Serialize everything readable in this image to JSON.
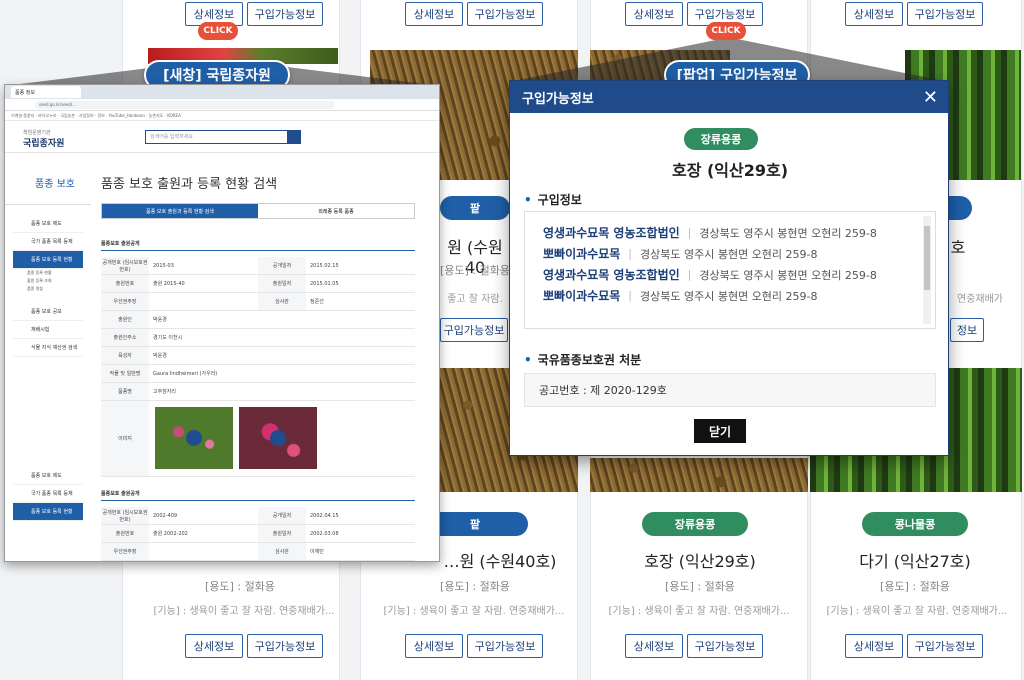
{
  "colors": {
    "navy": "#1f4b8a",
    "blue": "#1f5fa8",
    "green": "#2f8d5f",
    "click_red": "#e8503a"
  },
  "top_buttons": {
    "detail": "상세정보",
    "buy": "구입가능정보"
  },
  "callouts": {
    "click": "CLICK",
    "new_window": "[새창] 국립종자원",
    "popup": "[팝업] 구입가능정보"
  },
  "cards": [
    {
      "badge": "팥",
      "title": "…원 (수원40호)",
      "use": "[용도] : 절화용",
      "func": "[기능] : 생육이 좋고 잘 자람. 연중재배가..."
    },
    {
      "badge": "장류용콩",
      "title": "호장 (익산29호)",
      "use": "[용도] : 절화용",
      "func": "[기능] : 생육이 좋고 잘 자람. 연중재배가..."
    },
    {
      "badge": "콩나물콩",
      "title": "다기 (익산27호)",
      "use": "[용도] : 절화용",
      "func": "[기능] : 생육이 좋고 잘 자람. 연중재배가..."
    }
  ],
  "mid_cards": {
    "badge": "팥",
    "title": "원 (수원40",
    "use": "[용도] : 절화용",
    "func": "좋고 잘 자람."
  },
  "right_mid": {
    "func": "연중재배가"
  },
  "browser": {
    "tab": "품종 정보",
    "url": "seed.go.kr/seed/...",
    "bookmarks": "기계설·품종지 · 바이오누리 · 국립농촌 · 사업정보 · 정보 · YouTube_Hanbeon · 농촌지도 · KOREA",
    "logo_small": "책임운영기관",
    "logo": "국립종자원",
    "search_placeholder": "검색어를 입력하세요",
    "side_title": "품종 보호",
    "side_items": [
      "품종 보호 제도",
      "국가 품종 목록 등재",
      "품종 보호 등록 현황",
      "품종 보호 공보",
      "재배시험",
      "식물 지식 재산권 검색"
    ],
    "side_sub": [
      "품종 등록 현황",
      "출원 등록 조회",
      "품종 명칭"
    ],
    "side_items2": [
      "품종 보호 제도",
      "국가 품종 목록 등재",
      "품종 보호 등록 현황"
    ],
    "page_title": "품종 보호 출원과 등록 현황 검색",
    "tab1": "품종 보호 출원과 등록 현황 검색",
    "tab2": "외래종 등록 품종",
    "sec1": "품종보호 출원공개",
    "rows": [
      {
        "k": "공개번호 (임시보호권번호)",
        "v": "2015-03",
        "k2": "공개일자",
        "v2": "2015.02.15"
      },
      {
        "k": "출원번호",
        "v": "출원 2015-40",
        "k2": "출원일자",
        "v2": "2015.01.05"
      },
      {
        "k": "우선권주장",
        "v": "",
        "k2": "심사관",
        "v2": "정준선"
      },
      {
        "k": "출원인",
        "v": "박윤경",
        "k2": "",
        "v2": ""
      },
      {
        "k": "출원인주소",
        "v": "경기도 이천시",
        "k2": "",
        "v2": ""
      },
      {
        "k": "육성자",
        "v": "박윤경",
        "k2": "",
        "v2": ""
      },
      {
        "k": "작물 및 일반명",
        "v": "Gaura lindheimeri (가우라)",
        "k2": "",
        "v2": ""
      },
      {
        "k": "품종명",
        "v": "고추잠자리",
        "k2": "",
        "v2": ""
      }
    ],
    "image_label": "이미지",
    "sec2": "품종보호 출원공개",
    "rows2": [
      {
        "k": "공개번호 (임시보호권번호)",
        "v": "2002-409",
        "k2": "공개일자",
        "v2": "2002.04.15"
      },
      {
        "k": "출원번호",
        "v": "출원 2002-202",
        "k2": "출원일자",
        "v2": "2002.03.08"
      },
      {
        "k": "우선권주장",
        "v": "",
        "k2": "심사관",
        "v2": "이재민"
      }
    ]
  },
  "popup": {
    "title": "구입가능정보",
    "tag": "장류용콩",
    "name": "호장 (익산29호)",
    "sec_purchase": "구입정보",
    "sellers": [
      {
        "name": "영생과수묘목 영농조합법인",
        "addr": "경상북도 영주시 봉현면 오현리 259-8"
      },
      {
        "name": "뽀빠이과수묘목",
        "addr": "경상북도 영주시 봉현면 오현리 259-8"
      },
      {
        "name": "영생과수묘목 영농조합법인",
        "addr": "경상북도 영주시 봉현면 오현리 259-8"
      },
      {
        "name": "뽀빠이과수묘목",
        "addr": "경상북도 영주시 봉현면 오현리 259-8"
      }
    ],
    "sec_rights": "국유품종보호권 처분",
    "notice": "공고번호 : 제 2020-129호",
    "close": "닫기"
  }
}
